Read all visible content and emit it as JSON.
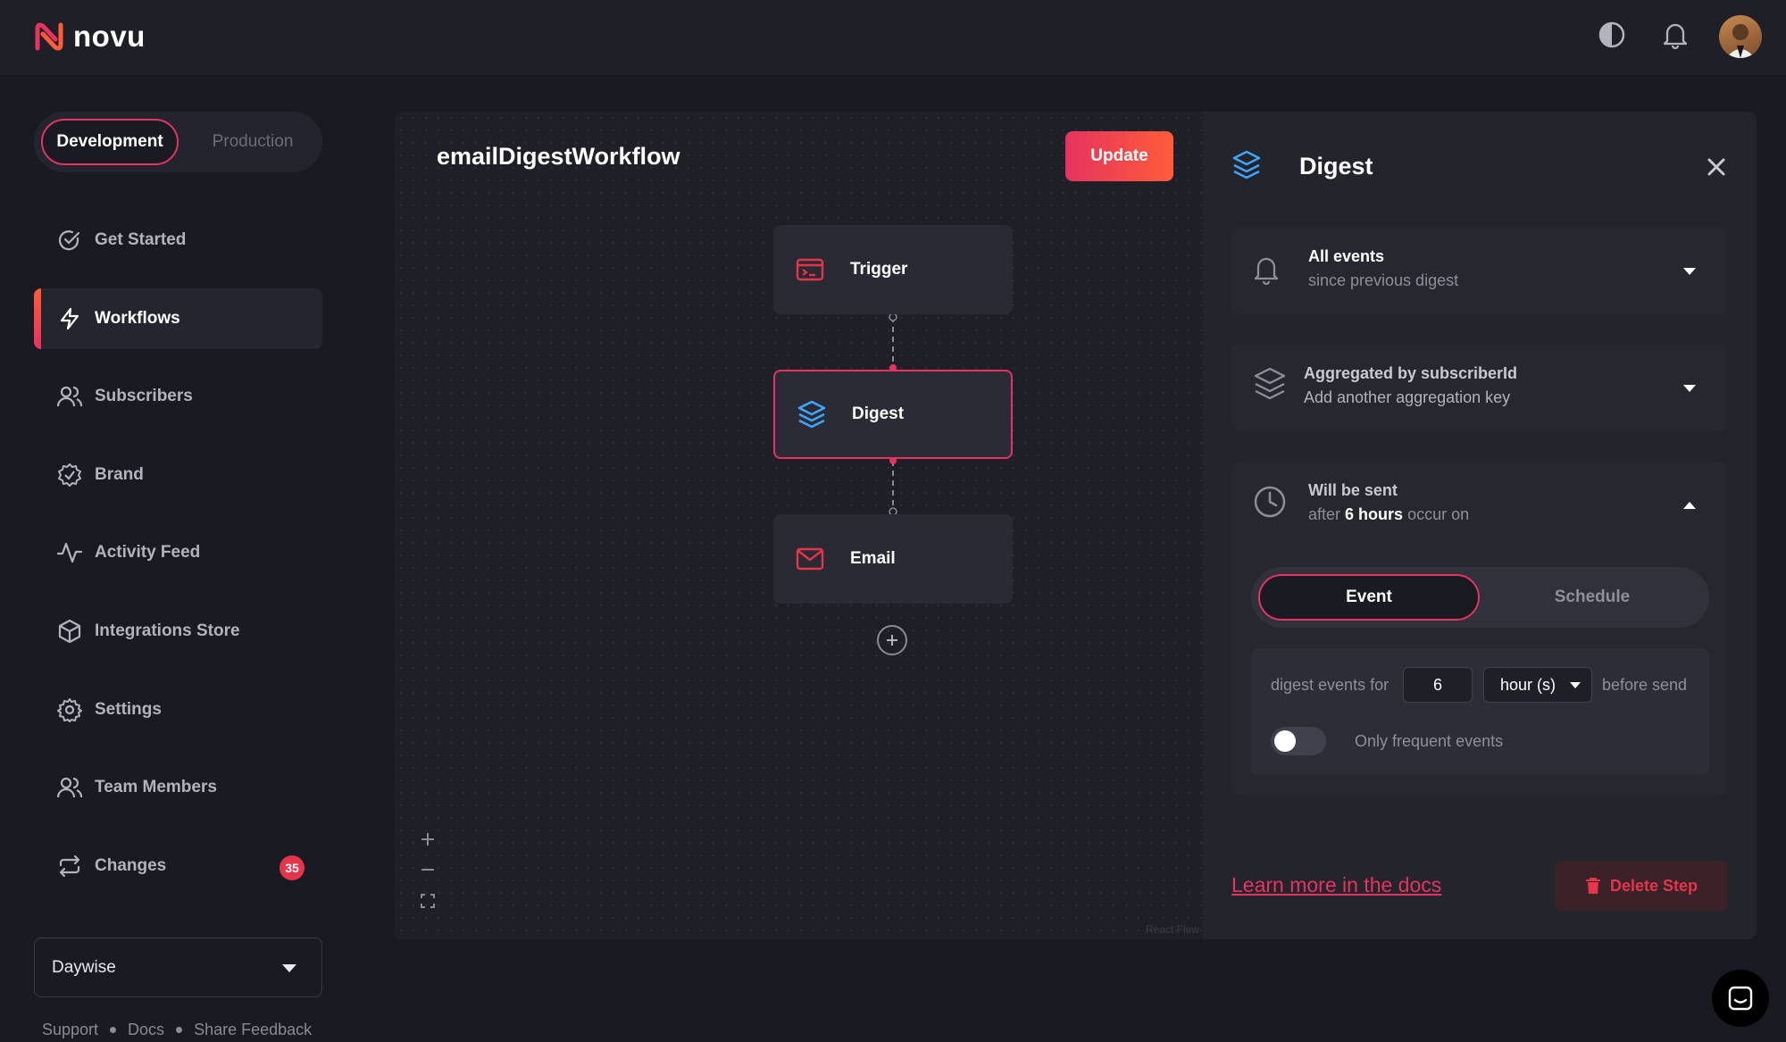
{
  "brand": {
    "name": "novu"
  },
  "environment": {
    "options": [
      "Development",
      "Production"
    ],
    "selected": "Development"
  },
  "nav": [
    {
      "label": "Get Started",
      "icon": "check-circle-icon"
    },
    {
      "label": "Workflows",
      "icon": "bolt-icon",
      "active": true
    },
    {
      "label": "Subscribers",
      "icon": "users-icon"
    },
    {
      "label": "Brand",
      "icon": "badge-check-icon"
    },
    {
      "label": "Activity Feed",
      "icon": "activity-icon"
    },
    {
      "label": "Integrations Store",
      "icon": "box-icon"
    },
    {
      "label": "Settings",
      "icon": "gear-icon"
    },
    {
      "label": "Team Members",
      "icon": "users-icon"
    },
    {
      "label": "Changes",
      "icon": "repeat-icon",
      "badge": "35"
    }
  ],
  "organization": {
    "selected": "Daywise"
  },
  "footer": {
    "links": [
      "Support",
      "Docs",
      "Share Feedback"
    ]
  },
  "workflow": {
    "title": "emailDigestWorkflow",
    "update_label": "Update",
    "nodes": [
      {
        "label": "Trigger",
        "icon": "terminal-icon"
      },
      {
        "label": "Digest",
        "icon": "layers-icon",
        "selected": true
      },
      {
        "label": "Email",
        "icon": "mail-icon"
      }
    ],
    "attribution": "React Flow"
  },
  "panel": {
    "title": "Digest",
    "events_card": {
      "line1": "All events",
      "line2": "since previous digest"
    },
    "aggregation_card": {
      "line1": "Aggregated by subscriberId",
      "line2": "Add another aggregation key"
    },
    "send_card": {
      "line1": "Will be sent",
      "line2_pre": "after",
      "line2_bold": "6 hours",
      "line2_post": "occur on",
      "mode_options": [
        "Event",
        "Schedule"
      ],
      "mode_selected": "Event",
      "digest_prefix": "digest events for",
      "amount": "6",
      "unit": "hour (s)",
      "digest_suffix": "before send",
      "frequent_label": "Only frequent events",
      "frequent_enabled": false
    },
    "docs_link": "Learn more in the docs",
    "delete_label": "Delete Step"
  },
  "colors": {
    "accent": "#e6335f",
    "accent2": "#ff5c3a",
    "danger": "#e5354b",
    "bg": "#1a1a22"
  }
}
